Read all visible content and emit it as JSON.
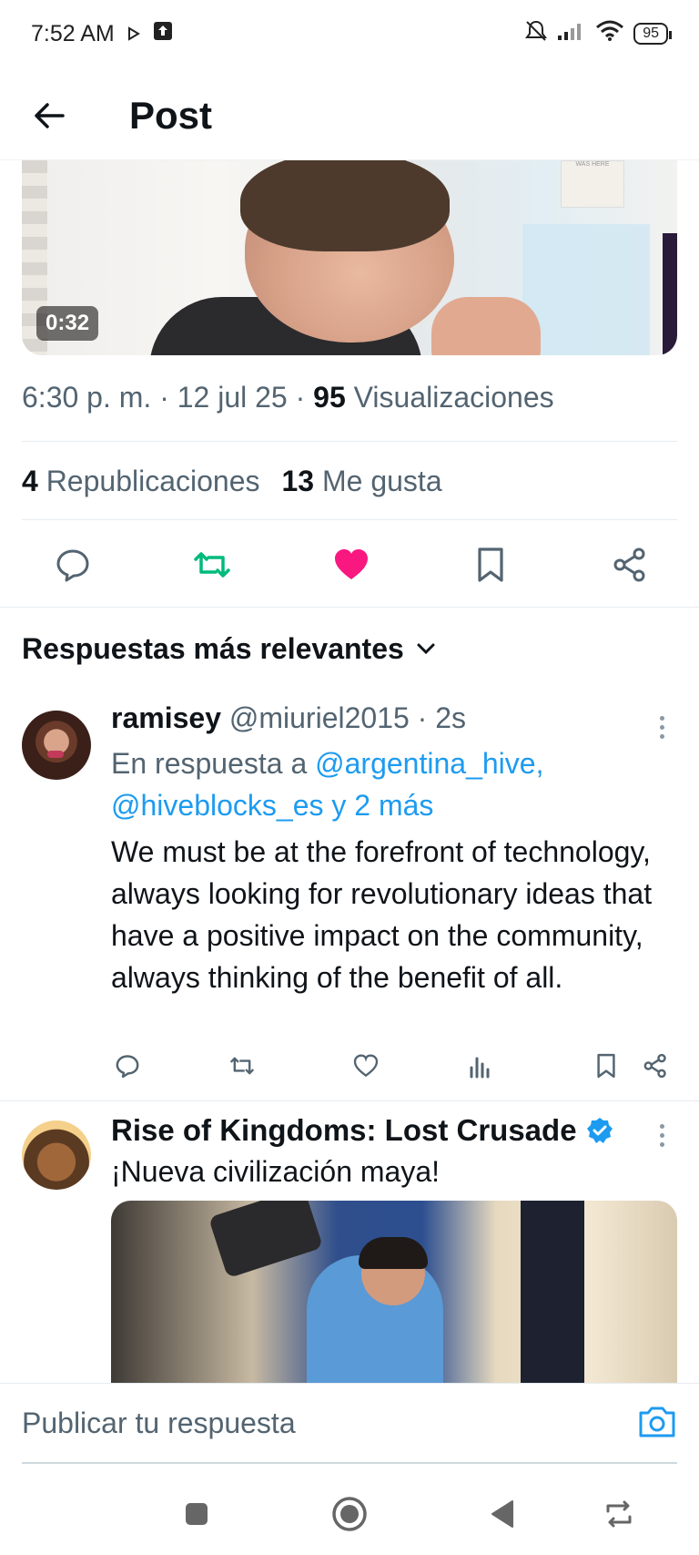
{
  "status_bar": {
    "time": "7:52 AM",
    "battery": "95"
  },
  "header": {
    "title": "Post"
  },
  "media": {
    "duration": "0:32",
    "poster_text": "WAS HERE"
  },
  "post": {
    "time": "6:30 p. m.",
    "date": "12 jul 25",
    "views_count": "95",
    "views_label": "Visualizaciones",
    "reposts_count": "4",
    "reposts_label": "Republicaciones",
    "likes_count": "13",
    "likes_label": "Me gusta",
    "liked": true,
    "reposted": true
  },
  "sort": {
    "label": "Respuestas más relevantes"
  },
  "reply": {
    "name": "ramisey",
    "handle": "@miuriel2015",
    "age": "2s",
    "reply_prefix": "En respuesta a",
    "mention1": "@argentina_hive,",
    "mention2": "@hiveblocks_es y 2 más",
    "text": "We must be at the forefront of technology, always looking for revolutionary ideas that have a positive impact on the community, always thinking of the benefit of all."
  },
  "ad": {
    "name": "Rise of Kingdoms: Lost Crusade",
    "verified": true,
    "text": "¡Nueva civilización maya!"
  },
  "reply_box": {
    "placeholder": "Publicar tu respuesta"
  },
  "colors": {
    "accent": "#1d9bf0",
    "like": "#f91880",
    "repost": "#00ba7c",
    "muted": "#536471"
  },
  "icons": {
    "back": "arrow-left-icon",
    "reply": "comment-icon",
    "repost": "repost-icon",
    "like": "heart-icon",
    "bookmark": "bookmark-icon",
    "share": "share-icon",
    "views": "bar-chart-icon",
    "camera": "camera-icon"
  }
}
